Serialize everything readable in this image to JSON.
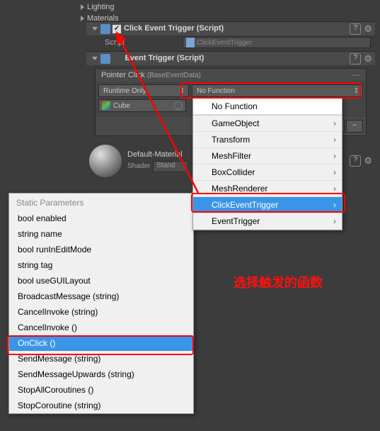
{
  "tree": {
    "lighting": "Lighting",
    "materials": "Materials"
  },
  "comp1": {
    "title": "Click Event Trigger (Script)",
    "scriptLabel": "Script",
    "scriptValue": "ClickEventTrigger"
  },
  "comp2": {
    "title": "Event Trigger (Script)",
    "eventName": "Pointer Click",
    "eventSub": "(BaseEventData)",
    "runtime": "Runtime Only",
    "fn": "No Function",
    "obj": "Cube"
  },
  "dropdown": {
    "noFn": "No Function",
    "items": [
      "GameObject",
      "Transform",
      "MeshFilter",
      "BoxCollider",
      "MeshRenderer",
      "ClickEventTrigger",
      "EventTrigger"
    ]
  },
  "static": {
    "head": "Static Parameters",
    "items": [
      "bool enabled",
      "string name",
      "bool runInEditMode",
      "string tag",
      "bool useGUILayout",
      "BroadcastMessage (string)",
      "CancelInvoke (string)",
      "CancelInvoke ()",
      "OnClick ()",
      "SendMessage (string)",
      "SendMessageUpwards (string)",
      "StopAllCoroutines ()",
      "StopCoroutine (string)"
    ]
  },
  "mat": {
    "title": "Default-Material",
    "shaderLabel": "Shader",
    "shaderValue": "Stand"
  },
  "anno": "选择触发的函数"
}
